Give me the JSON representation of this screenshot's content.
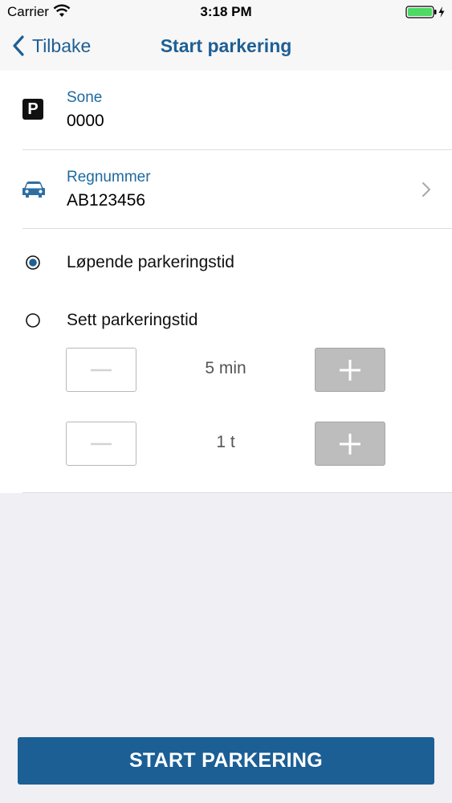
{
  "status_bar": {
    "carrier": "Carrier",
    "time": "3:18 PM",
    "icons": [
      "wifi-icon",
      "battery-icon",
      "charging-bolt-icon"
    ]
  },
  "nav": {
    "back_label": "Tilbake",
    "title": "Start parkering"
  },
  "zone": {
    "icon_glyph": "P",
    "label": "Sone",
    "value": "0000"
  },
  "registration": {
    "label": "Regnummer",
    "value": "AB123456"
  },
  "options": [
    {
      "label": "Løpende parkeringstid",
      "selected": true
    },
    {
      "label": "Sett parkeringstid",
      "selected": false
    }
  ],
  "steppers": [
    {
      "value": "5 min"
    },
    {
      "value": "1 t"
    }
  ],
  "action": {
    "start_label": "START PARKERING"
  },
  "colors": {
    "accent": "#1e5f94",
    "label_blue": "#1e6a9e",
    "button_bg": "#1b5f95",
    "battery_green": "#4cd964",
    "plus_button_bg": "#bdbdbd",
    "page_bg": "#efeff4"
  }
}
